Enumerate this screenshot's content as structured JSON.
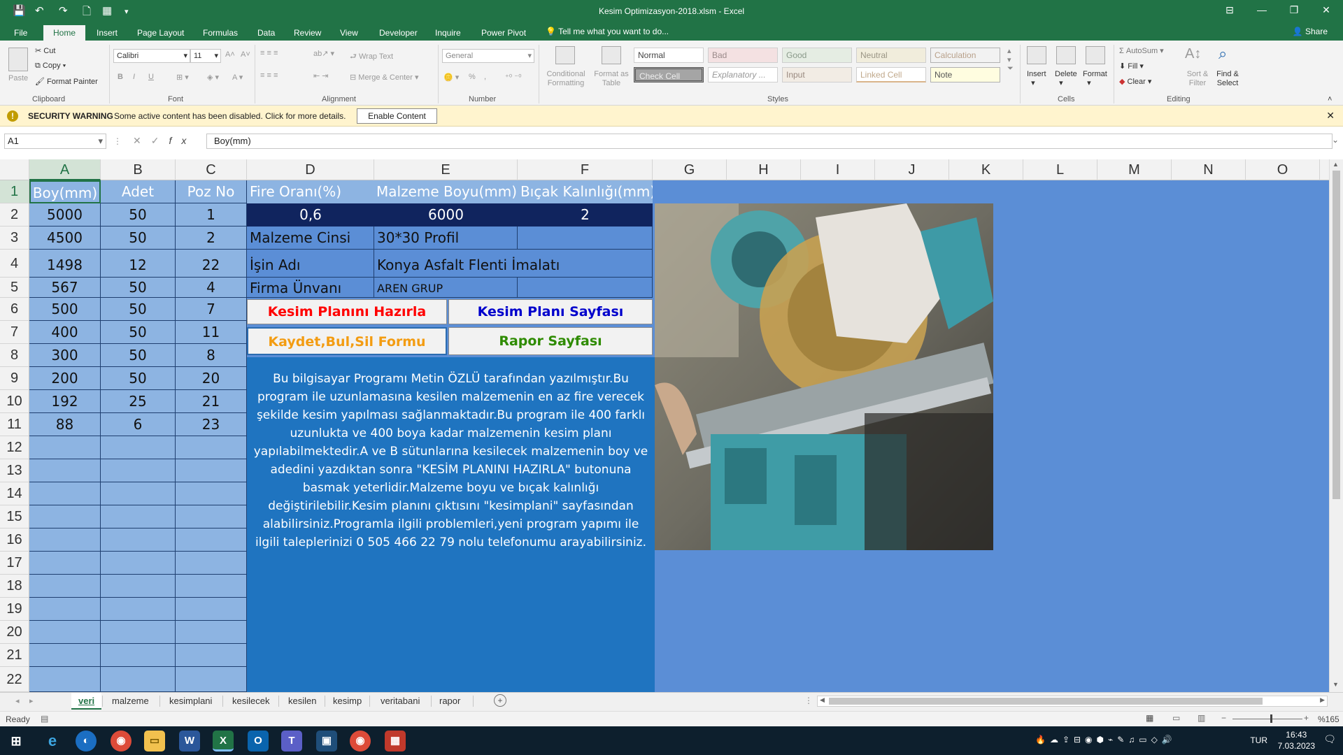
{
  "window": {
    "title": "Kesim Optimizasyon-2018.xlsm - Excel",
    "controls": [
      "⊟",
      "—",
      "❐",
      "✕"
    ]
  },
  "ribbon_tabs": [
    "File",
    "Home",
    "Insert",
    "Page Layout",
    "Formulas",
    "Data",
    "Review",
    "View",
    "Developer",
    "Inquire",
    "Power Pivot"
  ],
  "tell_me": "Tell me what you want to do...",
  "share": "Share",
  "ribbon": {
    "clipboard": {
      "paste": "Paste",
      "cut": "Cut",
      "copy": "Copy",
      "format_painter": "Format Painter",
      "label": "Clipboard"
    },
    "font": {
      "name": "Calibri",
      "size": "11",
      "label": "Font",
      "bold": "B",
      "italic": "I",
      "underline": "U"
    },
    "alignment": {
      "wrap": "Wrap Text",
      "merge": "Merge & Center",
      "label": "Alignment"
    },
    "number": {
      "format": "General",
      "percent": "%",
      "comma": ",",
      "label": "Number"
    },
    "styles": {
      "conditional": "Conditional Formatting",
      "format_table": "Format as Table",
      "cells": [
        "Normal",
        "Bad",
        "Good",
        "Neutral",
        "Calculation",
        "Check Cell",
        "Explanatory ...",
        "Input",
        "Linked Cell",
        "Note"
      ],
      "label": "Styles"
    },
    "cells": {
      "insert": "Insert",
      "delete": "Delete",
      "format": "Format",
      "label": "Cells"
    },
    "editing": {
      "autosum": "AutoSum",
      "fill": "Fill",
      "clear": "Clear",
      "sort": "Sort & Filter",
      "find": "Find & Select",
      "label": "Editing"
    }
  },
  "security": {
    "label": "SECURITY WARNING",
    "message": "Some active content has been disabled. Click for more details.",
    "button": "Enable Content"
  },
  "formula_bar": {
    "name_box": "A1",
    "formula": "Boy(mm)",
    "fx": "fx"
  },
  "columns": [
    "A",
    "B",
    "C",
    "D",
    "E",
    "F",
    "G",
    "H",
    "I",
    "J",
    "K",
    "L",
    "M",
    "N",
    "O"
  ],
  "rows": [
    "1",
    "2",
    "3",
    "4",
    "5",
    "6",
    "7",
    "8",
    "9",
    "10",
    "11",
    "12",
    "13",
    "14",
    "15",
    "16",
    "17",
    "18",
    "19",
    "20",
    "21",
    "22"
  ],
  "table": {
    "headers": [
      "Boy(mm)",
      "Adet",
      "Poz No"
    ],
    "rows": [
      [
        "5000",
        "50",
        "1"
      ],
      [
        "4500",
        "50",
        "2"
      ],
      [
        "1498",
        "12",
        "22"
      ],
      [
        "567",
        "50",
        "4"
      ],
      [
        "500",
        "50",
        "7"
      ],
      [
        "400",
        "50",
        "11"
      ],
      [
        "300",
        "50",
        "8"
      ],
      [
        "200",
        "50",
        "20"
      ],
      [
        "192",
        "25",
        "21"
      ],
      [
        "88",
        "6",
        "23"
      ]
    ]
  },
  "params": {
    "fire_label": "Fire Oranı(%)",
    "malzeme_boyu_label": "Malzeme Boyu(mm)",
    "bicak_label": "Bıçak Kalınlığı(mm)",
    "fire_value": "0,6",
    "malzeme_boyu_value": "6000",
    "bicak_value": "2",
    "malzeme_cinsi_label": "Malzeme Cinsi",
    "malzeme_cinsi_value": "30*30 Profil",
    "isin_adi_label": "İşin Adı",
    "isin_adi_value": "Konya Asfalt Flenti İmalatı",
    "firma_label": "Firma  Ünvanı",
    "firma_value": "AREN GRUP"
  },
  "buttons": {
    "kesim_hazirla": "Kesim Planını Hazırla",
    "kesim_sayfasi": "Kesim Planı Sayfası",
    "kaydet": "Kaydet,Bul,Sil Formu",
    "rapor": "Rapor Sayfası"
  },
  "description": "Bu bilgisayar Programı Metin ÖZLÜ tarafından yazılmıştır.Bu program ile uzunlamasına kesilen malzemenin en az fire verecek şekilde kesim yapılması sağlanmaktadır.Bu program ile 400 farklı uzunlukta ve 400 boya kadar malzemenin  kesim planı yapılabilmektedir.A ve B sütunlarına kesilecek malzemenin boy ve adedini  yazdıktan sonra \"KESİM PLANINI HAZIRLA\" butonuna basmak yeterlidir.Malzeme boyu ve bıçak kalınlığı değiştirilebilir.Kesim planını çıktısını \"kesimplani\" sayfasından alabilirsiniz.Programla ilgili problemleri,yeni program yapımı ile ilgili taleplerinizi 0 505 466 22 79 nolu telefonumu arayabilirsiniz.",
  "sheets": [
    "veri",
    "malzeme",
    "kesimplani",
    "kesilecek",
    "kesilen",
    "kesimp",
    "veritabani",
    "rapor"
  ],
  "status": {
    "ready": "Ready",
    "zoom": "%165"
  },
  "taskbar": {
    "lang": "TUR",
    "time": "16:43",
    "date": "7.03.2023"
  },
  "colors": {
    "excel_green": "#217346",
    "sheet_bg": "#5b8ed6",
    "cell_blue": "#8db4e2",
    "dark_navy": "#10245e",
    "red_btn": "#ff0000",
    "blue_btn": "#0000cc",
    "orange_btn": "#f39c12",
    "green_btn": "#2e8b00"
  }
}
